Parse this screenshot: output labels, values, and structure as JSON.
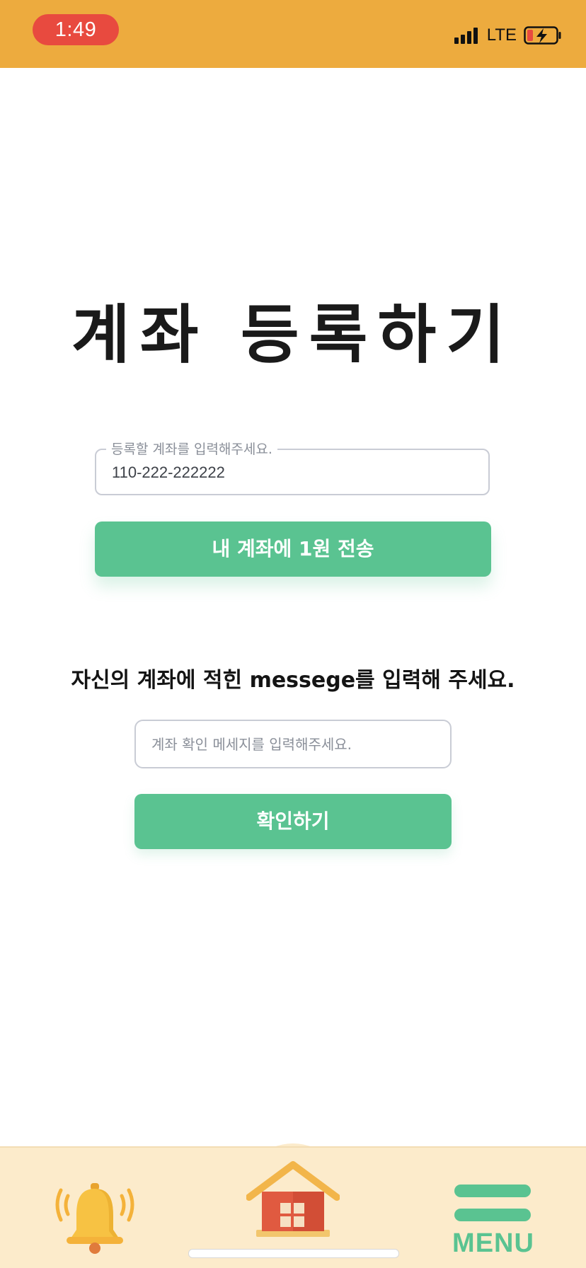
{
  "status_bar": {
    "time": "1:49",
    "network": "LTE",
    "background_color": "#EDAB3E",
    "time_pill_color": "#E84A3F",
    "signal_icon": "signal-bars-icon",
    "battery_icon": "battery-charging-low-icon"
  },
  "page": {
    "title": "계좌 등록하기"
  },
  "account_field": {
    "label": "등록할 계좌를 입력해주세요.",
    "value": "110-222-222222"
  },
  "send_button": {
    "label": "내 계좌에 1원 전송"
  },
  "instruction": {
    "text": "자신의 계좌에 적힌 messege를 입력해 주세요."
  },
  "message_field": {
    "placeholder": "계좌 확인 메세지를 입력해주세요.",
    "value": ""
  },
  "confirm_button": {
    "label": "확인하기"
  },
  "bottom_nav": {
    "background_color": "#FCEBCB",
    "accent_color": "#5AC391",
    "items": [
      {
        "icon": "bell-icon"
      },
      {
        "icon": "home-icon"
      },
      {
        "icon": "menu-icon",
        "label": "MENU"
      }
    ]
  }
}
